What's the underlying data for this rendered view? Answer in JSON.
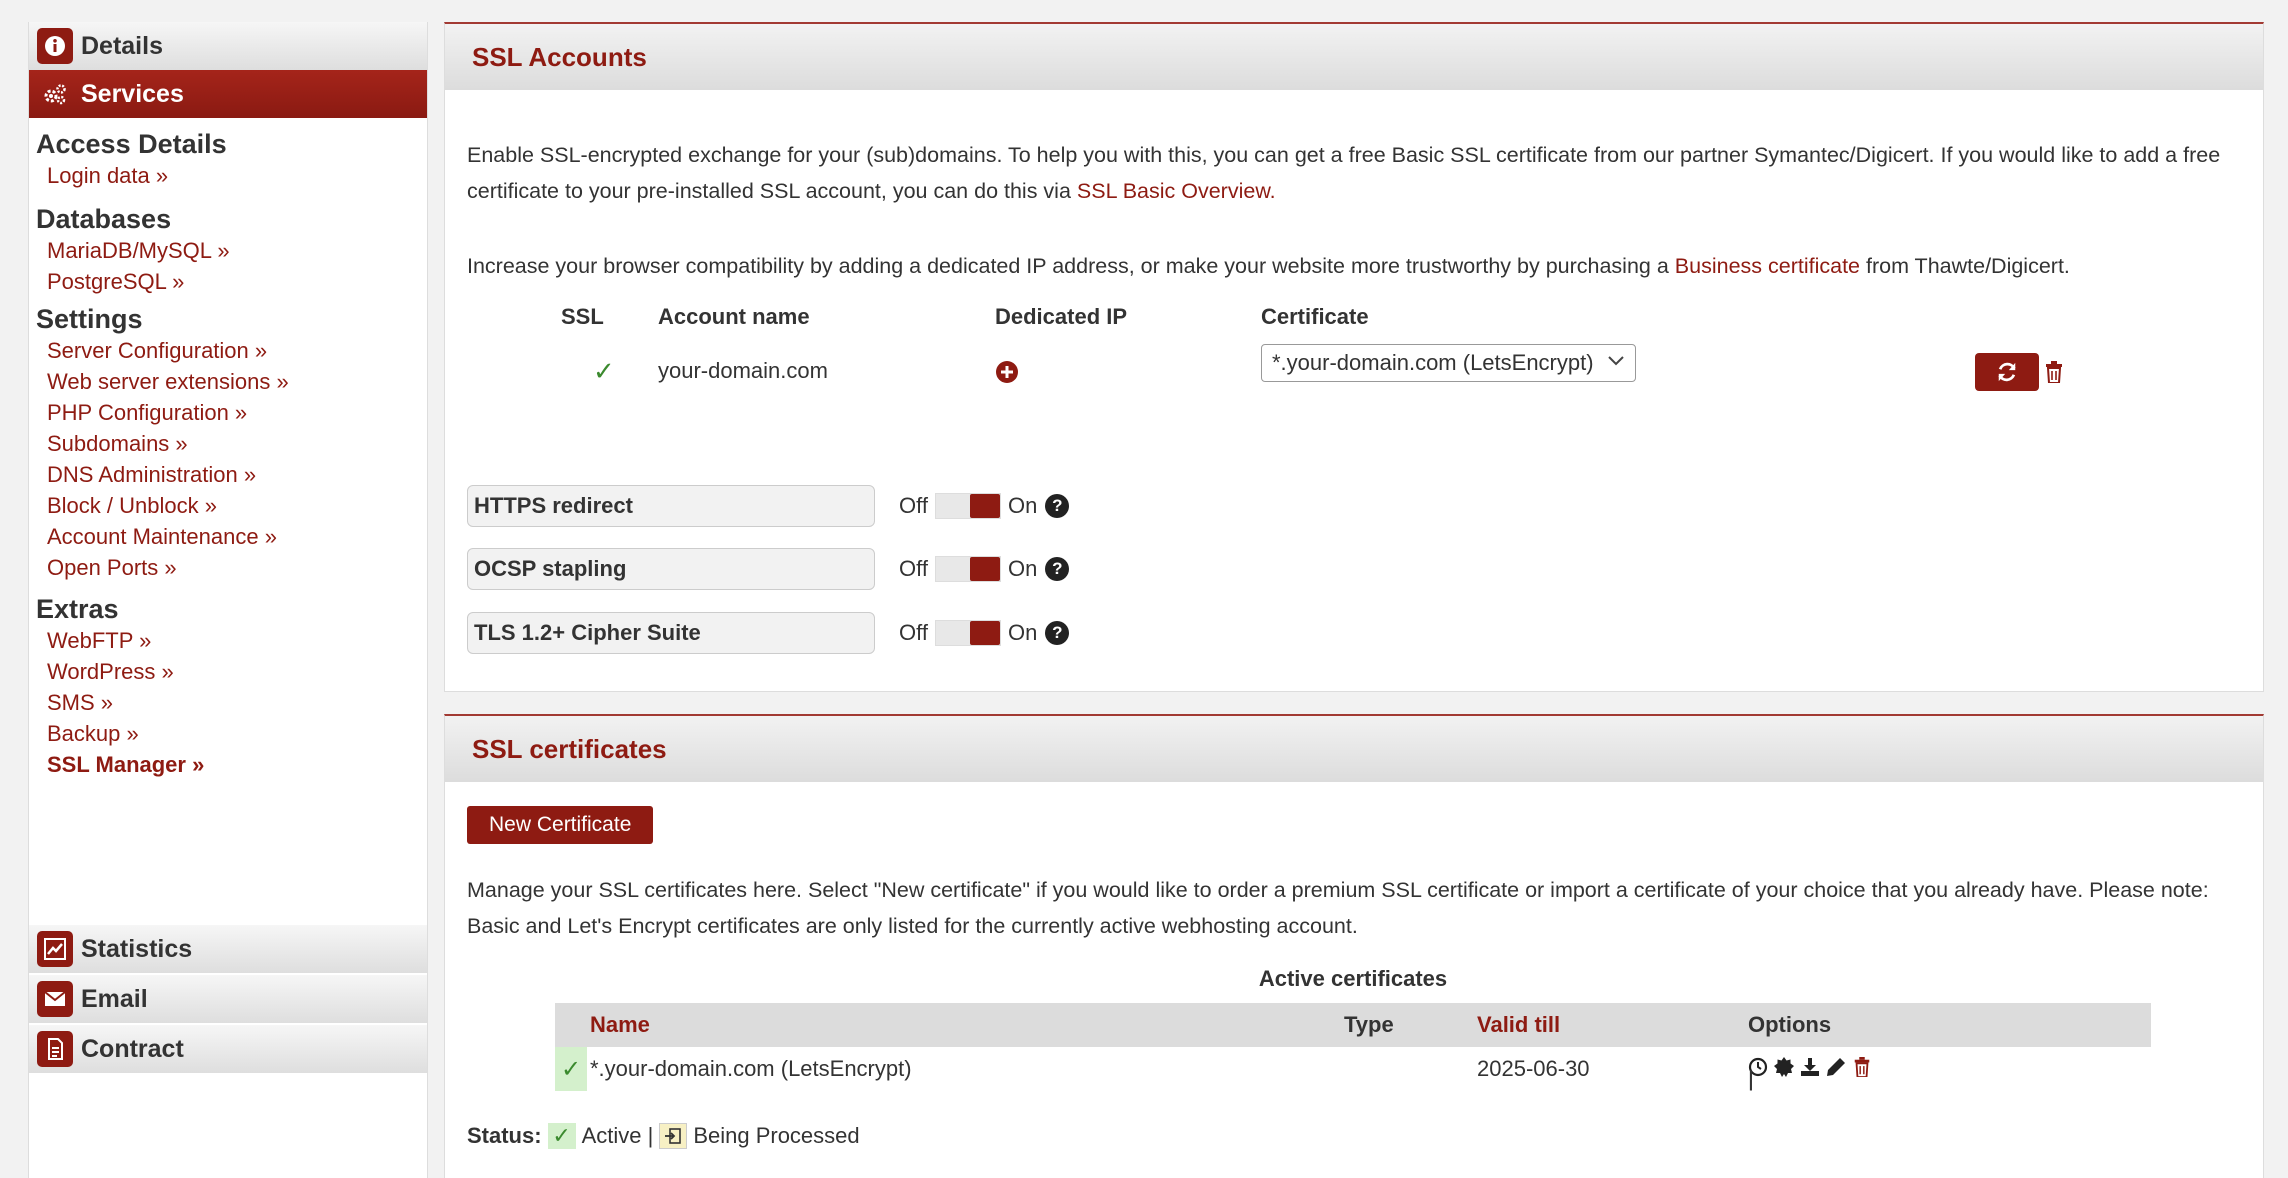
{
  "sidebar": {
    "details": "Details",
    "services": "Services",
    "sections": [
      {
        "title": "Access Details",
        "links": [
          "Login data »"
        ]
      },
      {
        "title": "Databases",
        "links": [
          "MariaDB/MySQL »",
          "PostgreSQL »"
        ]
      },
      {
        "title": "Settings",
        "links": [
          "Server Configuration »",
          "Web server extensions »",
          "PHP Configuration »",
          "Subdomains »",
          "DNS Administration »",
          "Block / Unblock »",
          "Account Maintenance »",
          "Open Ports »"
        ]
      },
      {
        "title": "Extras",
        "links": [
          "WebFTP »",
          "WordPress »",
          "SMS »",
          "Backup »",
          "SSL Manager »"
        ]
      }
    ],
    "statistics": "Statistics",
    "email": "Email",
    "contract": "Contract"
  },
  "accounts": {
    "title": "SSL Accounts",
    "intro1_a": "Enable SSL-encrypted exchange for your (sub)domains. To help you with this, you can get a free Basic SSL certificate from our partner Symantec/Digicert. If you would like to add a free certificate to your pre-installed SSL account, you can do this via ",
    "intro1_link": "SSL Basic Overview.",
    "intro2_a": "Increase your browser compatibility by adding a dedicated IP address, or make your website more trustworthy by purchasing a ",
    "intro2_link": "Business certificate",
    "intro2_b": " from Thawte/Digicert.",
    "columns": {
      "ssl": "SSL",
      "account": "Account name",
      "ip": "Dedicated IP",
      "cert": "Certificate"
    },
    "row": {
      "ssl": "✓",
      "account": "your-domain.com",
      "cert_selected": "*.your-domain.com (LetsEncrypt)"
    },
    "options": [
      {
        "label": "HTTPS redirect",
        "off": "Off",
        "on": "On"
      },
      {
        "label": "OCSP stapling",
        "off": "Off",
        "on": "On"
      },
      {
        "label": "TLS 1.2+ Cipher Suite",
        "off": "Off",
        "on": "On"
      }
    ]
  },
  "certificates": {
    "title": "SSL certificates",
    "new_button": "New Certificate",
    "text": "Manage your SSL certificates here. Select \"New certificate\" if you would like to order a premium SSL certificate or import a certificate of your choice that you already have. Please note: Basic and Let's Encrypt certificates are only listed for the currently active webhosting account.",
    "table_caption": "Active certificates",
    "columns": {
      "name": "Name",
      "type": "Type",
      "valid": "Valid till",
      "options": "Options"
    },
    "row": {
      "name": "*.your-domain.com (LetsEncrypt)",
      "type": "",
      "valid": "2025-06-30"
    },
    "status_label": "Status:",
    "status_active": "Active |",
    "status_processing": "Being Processed"
  }
}
